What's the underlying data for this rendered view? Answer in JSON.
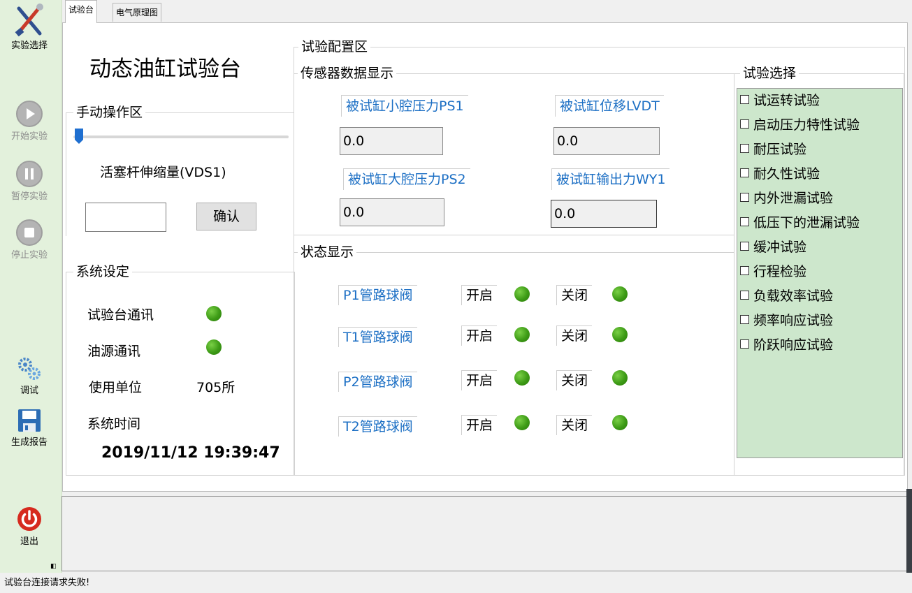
{
  "toolbar": {
    "select_label": "实验选择",
    "start_label": "开始实验",
    "pause_label": "暂停实验",
    "stop_label": "停止实验",
    "debug_label": "调试",
    "report_label": "生成报告",
    "exit_label": "退出"
  },
  "tabs": {
    "tab1": "试验台",
    "tab2": "电气原理图"
  },
  "header": {
    "title": "动态油缸试验台"
  },
  "manual": {
    "group_title": "手动操作区",
    "slider_value": 0,
    "param_label": "活塞杆伸缩量(VDS1)",
    "input_value": "",
    "confirm_label": "确认"
  },
  "system": {
    "group_title": "系统设定",
    "bench_comm_label": "试验台通讯",
    "oil_comm_label": "油源通讯",
    "unit_label": "使用单位",
    "unit_value": "705所",
    "time_label": "系统时间",
    "time_value": "2019/11/12 19:39:47"
  },
  "config": {
    "group_title": "试验配置区",
    "sensor_title": "传感器数据显示",
    "sensors": [
      {
        "label": "被试缸小腔压力PS1",
        "value": "0.0"
      },
      {
        "label": "被试缸位移LVDT",
        "value": "0.0"
      },
      {
        "label": "被试缸大腔压力PS2",
        "value": "0.0"
      },
      {
        "label": "被试缸输出力WY1",
        "value": "0.0"
      }
    ],
    "status_title": "状态显示",
    "valves": [
      {
        "name": "P1管路球阀",
        "open": "开启",
        "close": "关闭"
      },
      {
        "name": "T1管路球阀",
        "open": "开启",
        "close": "关闭"
      },
      {
        "name": "P2管路球阀",
        "open": "开启",
        "close": "关闭"
      },
      {
        "name": "T2管路球阀",
        "open": "开启",
        "close": "关闭"
      }
    ]
  },
  "tests": {
    "group_title": "试验选择",
    "items": [
      "试运转试验",
      "启动压力特性试验",
      "耐压试验",
      "耐久性试验",
      "内外泄漏试验",
      "低压下的泄漏试验",
      "缓冲试验",
      "行程检验",
      "负载效率试验",
      "频率响应试验",
      "阶跃响应试验"
    ]
  },
  "colors": {
    "led_on": "#3d9b16",
    "label_blue": "#1c6fc4",
    "checklist_bg": "#cde7cc",
    "toolbar_bg": "#e3f1dc"
  },
  "statusbar": {
    "message": "试验台连接请求失败!"
  }
}
